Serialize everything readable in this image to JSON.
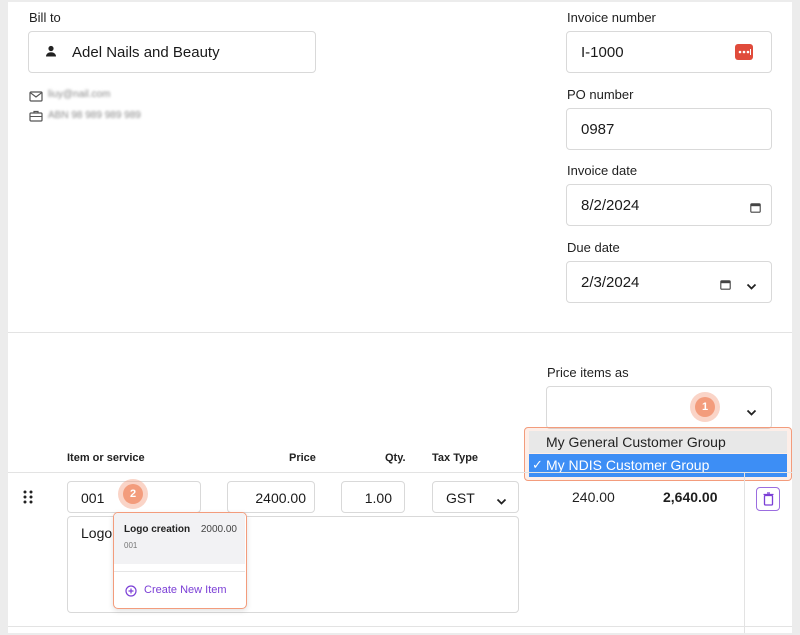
{
  "bill_to": {
    "label": "Bill to",
    "customer": "Adel Nails and Beauty",
    "email": "liuy@nail.com",
    "abn": "ABN 98 989 989 989"
  },
  "invoice_number": {
    "label": "Invoice number",
    "value": "I-1000"
  },
  "po_number": {
    "label": "PO number",
    "value": "0987"
  },
  "invoice_date": {
    "label": "Invoice date",
    "value": "8/2/2024"
  },
  "due_date": {
    "label": "Due date",
    "value": "2/3/2024"
  },
  "price_items": {
    "label": "Price items as",
    "selected": "",
    "options": [
      "My General Customer Group",
      "My NDIS Customer Group"
    ],
    "highlighted": "My NDIS Customer Group"
  },
  "table": {
    "headers": {
      "item": "Item or service",
      "price": "Price",
      "qty": "Qty.",
      "tax": "Tax Type"
    },
    "row": {
      "item_code": "001",
      "price": "2400.00",
      "qty": "1.00",
      "tax": "GST",
      "tax_amount": "240.00",
      "total": "2,640.00",
      "description": "Logo"
    }
  },
  "item_suggest": {
    "name": "Logo creation",
    "price": "2000.00",
    "code": "001",
    "create_label": "Create New Item"
  },
  "badges": {
    "one": "1",
    "two": "2"
  },
  "colors": {
    "accent_purple": "#7b3fd6",
    "badge_orange": "#f39c7c",
    "highlight_blue": "#3d8ef5",
    "password_red": "#e04b3b"
  }
}
